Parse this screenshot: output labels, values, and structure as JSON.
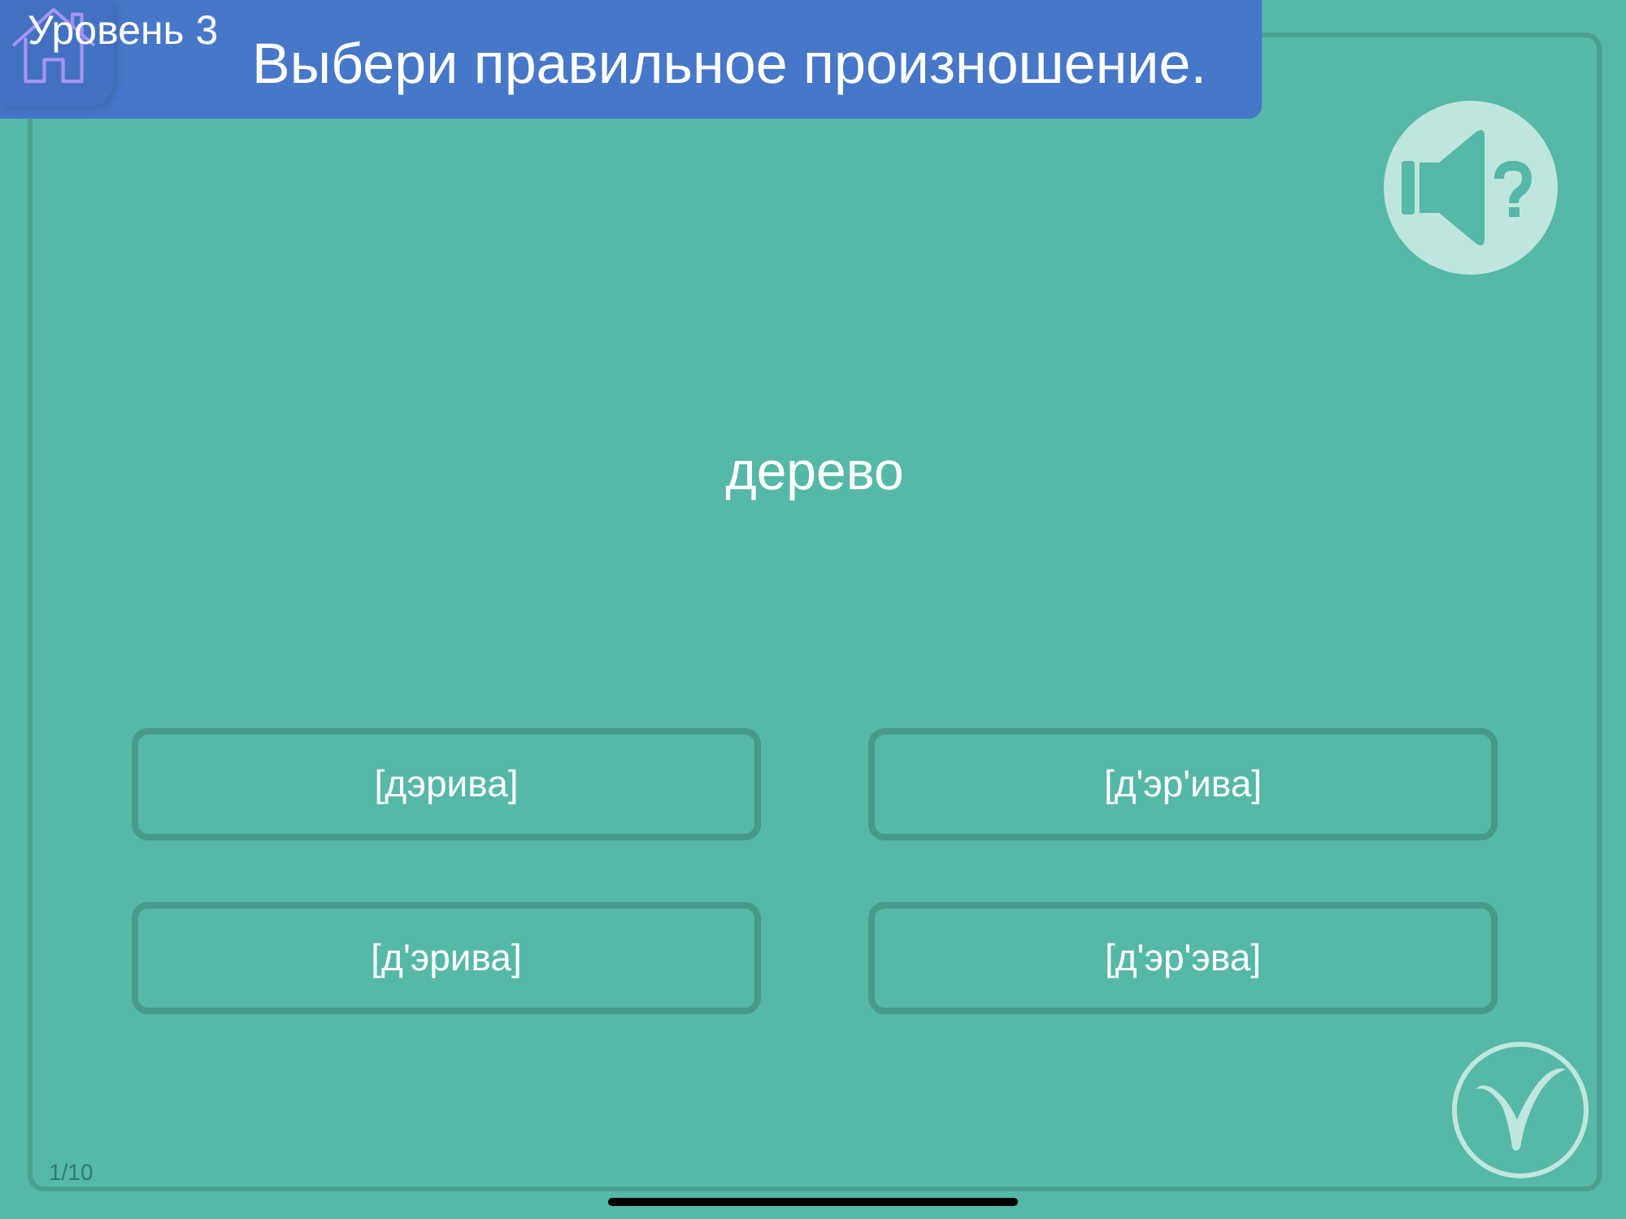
{
  "header": {
    "level_label": "Уровень 3",
    "instruction": "Выбери правильное произношение."
  },
  "word": "дерево",
  "options": [
    {
      "label": "[дэрива]",
      "selected": false
    },
    {
      "label": "[д'эр'ива]",
      "selected": false
    },
    {
      "label": "[д'эрива]",
      "selected": false
    },
    {
      "label": "[д'эр'эва]",
      "selected": false
    }
  ],
  "progress": "1/10"
}
